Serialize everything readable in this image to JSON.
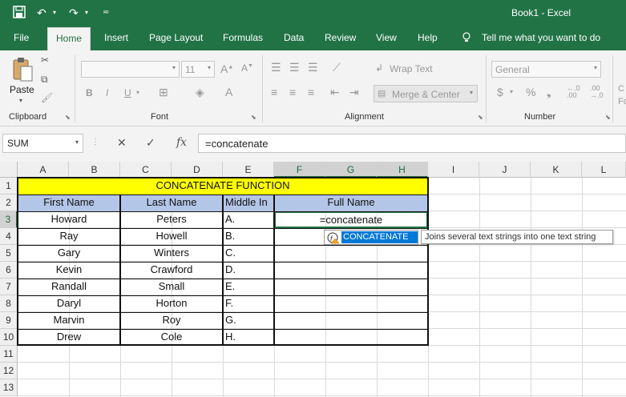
{
  "window": {
    "title": "Book1  -  Excel"
  },
  "tabs": [
    "File",
    "Home",
    "Insert",
    "Page Layout",
    "Formulas",
    "Data",
    "Review",
    "View",
    "Help",
    "Tell me what you want to do"
  ],
  "ribbon": {
    "groups": [
      "Clipboard",
      "Font",
      "Alignment",
      "Number"
    ],
    "paste_label": "Paste",
    "font_size": "11",
    "wrap_text": "Wrap Text",
    "merge_center": "Merge & Center",
    "number_format": "General",
    "percent": "%",
    "dollar": "$",
    "bold": "B",
    "italic": "I",
    "underline": "U"
  },
  "formula_bar": {
    "name_box": "SUM",
    "formula": "=concatenate",
    "fx": "fx"
  },
  "columns": [
    "A",
    "B",
    "C",
    "D",
    "E",
    "F",
    "G",
    "H",
    "I",
    "J",
    "K",
    "L"
  ],
  "rows": [
    "1",
    "2",
    "3",
    "4",
    "5",
    "6",
    "7",
    "8",
    "9",
    "10",
    "11",
    "12",
    "13"
  ],
  "sheet": {
    "title": "CONCATENATE FUNCTION",
    "headers": {
      "first": "First Name",
      "last": "Last Name",
      "middle": "Middle In",
      "full": "Full Name"
    },
    "editing_cell": "=concatenate",
    "first_names": [
      "Howard",
      "Ray",
      "Gary",
      "Kevin",
      "Randall",
      "Daryl",
      "Marvin",
      "Drew"
    ],
    "last_names": [
      "Peters",
      "Howell",
      "Winters",
      "Crawford",
      "Small",
      "Horton",
      "Roy",
      "Cole"
    ],
    "middle": [
      "A.",
      "B.",
      "C.",
      "D.",
      "E.",
      "F.",
      "G.",
      "H."
    ]
  },
  "autocomplete": {
    "item": "CONCATENATE",
    "tooltip": "Joins several text strings into one text string"
  },
  "colors": {
    "accent": "#217346",
    "title_fill": "#ffff00",
    "header_fill": "#b4c6e7",
    "ac_highlight": "#0078d7"
  }
}
